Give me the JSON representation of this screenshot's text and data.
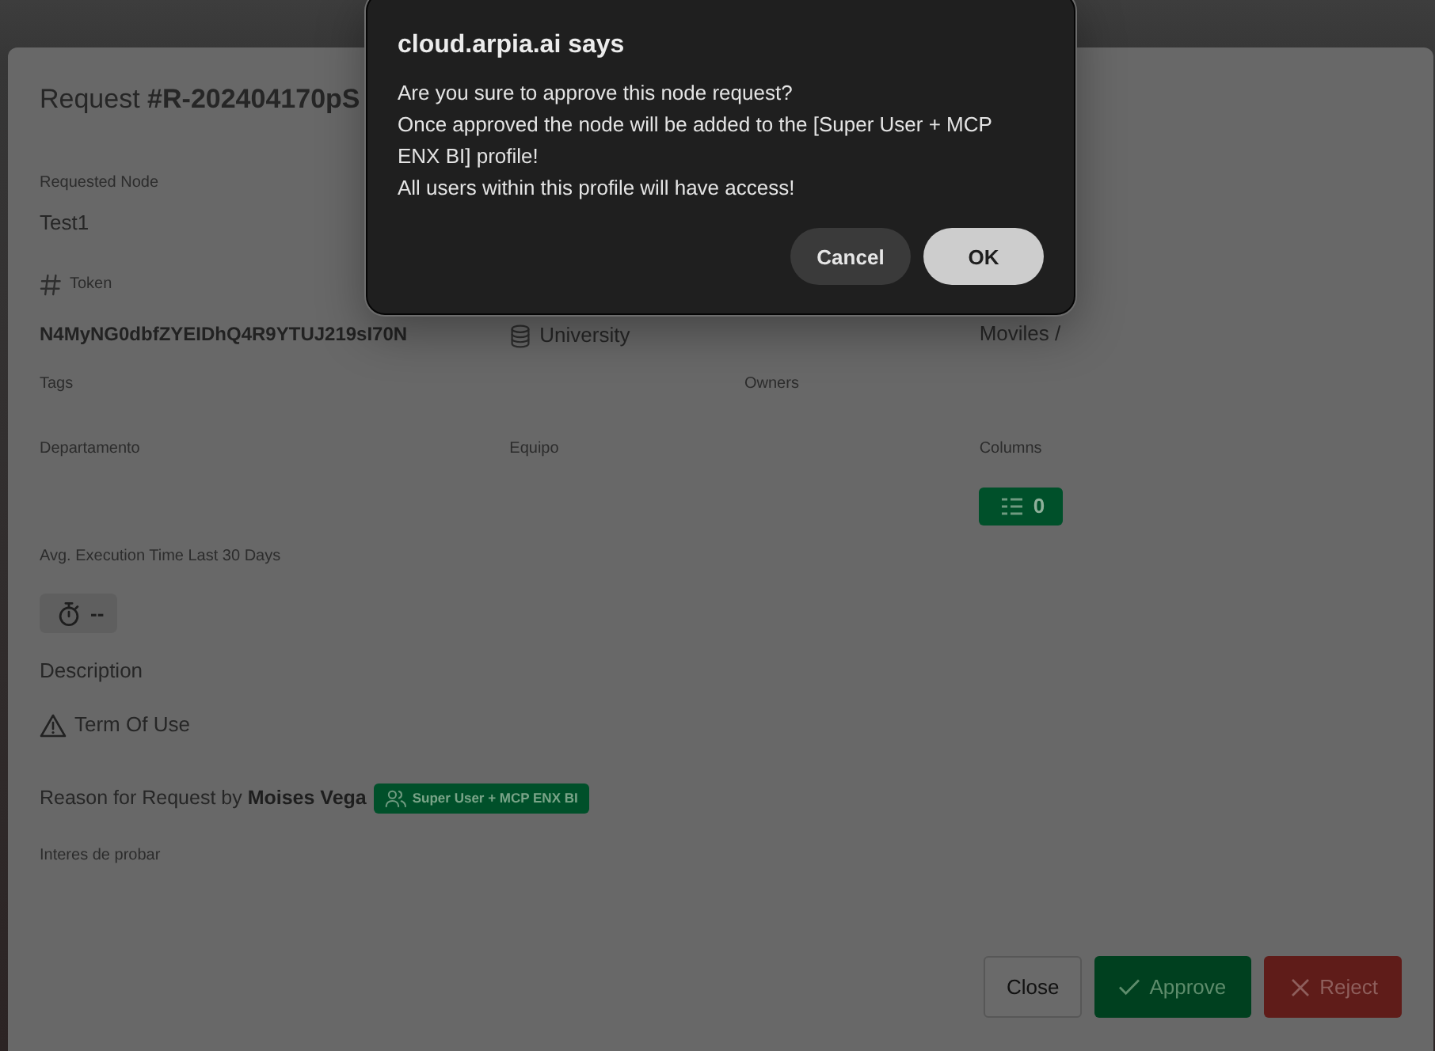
{
  "request": {
    "title": "Request **#R-202404170pS**",
    "requested_node": {
      "label": "Requested Node",
      "value": "Test1"
    },
    "token_row": {
      "token": {
        "label": "Token",
        "value": "N4MyNG0dbfZYEIDhQ4R9YTUJ219sI70N"
      },
      "column_2": {
        "value": "University"
      },
      "column_3": {
        "value": "Moviles /"
      }
    },
    "tags": {
      "label": "Tags"
    },
    "owners": {
      "label": "Owners"
    },
    "departamento": {
      "label": "Departamento"
    },
    "equipo": {
      "label": "Equipo"
    },
    "columns": {
      "label": "Columns",
      "count": "0"
    },
    "avg_execution_time": {
      "label": "Avg. Execution Time Last 30 Days",
      "value": "--"
    },
    "description": {
      "label": "Description"
    },
    "term_of_use": {
      "label": "Term Of Use"
    },
    "reason": {
      "heading": "Reason for Request by **Moises Vega**",
      "profile_badge": "Super User + MCP ENX BI",
      "text": "Interes de probar"
    },
    "buttons": [
      {
        "label": "Close",
        "kind": "close"
      },
      {
        "label": "Approve",
        "kind": "approve"
      },
      {
        "label": "Reject",
        "kind": "reject"
      }
    ]
  },
  "dialog": {
    "title": "cloud.arpia.ai says",
    "message": [
      "Are you sure to approve this node request?",
      "Once approved the node will be added to the [Super User + MCP ENX BI] profile!",
      "All users within this profile will have access!"
    ],
    "buttons": [
      {
        "label": "Cancel",
        "kind": "cancel"
      },
      {
        "label": "OK",
        "kind": "confirm"
      }
    ]
  }
}
